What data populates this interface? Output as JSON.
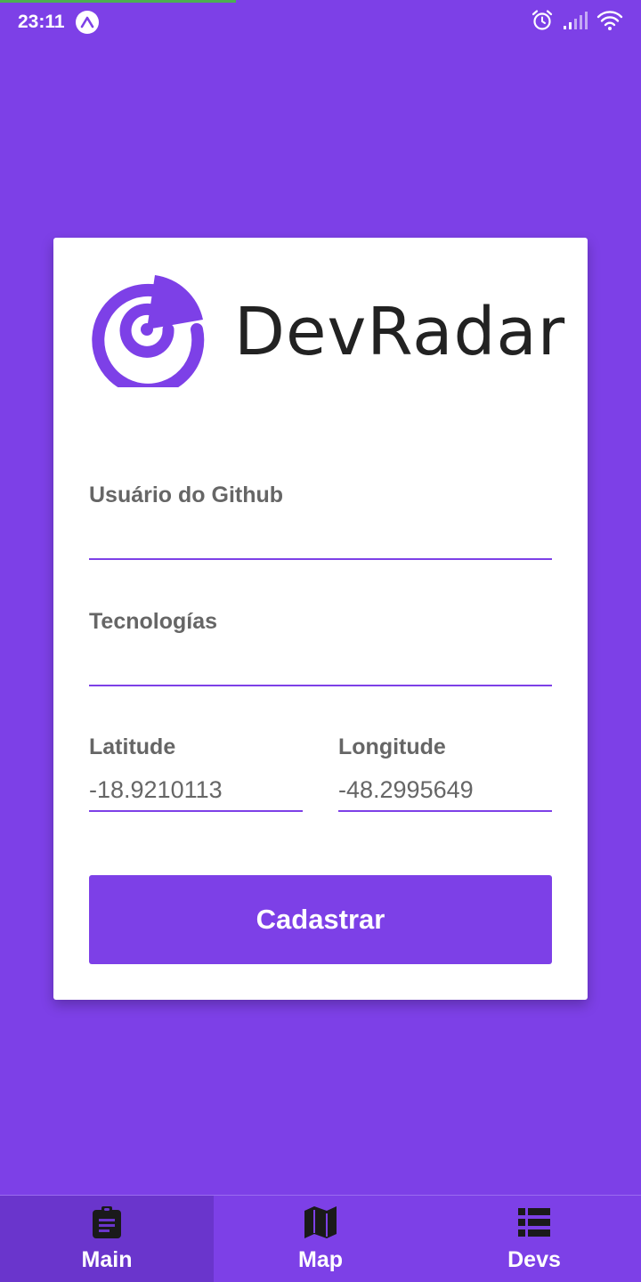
{
  "status_bar": {
    "time": "23:11",
    "icons": [
      "expo-icon",
      "alarm-icon",
      "signal-icon",
      "wifi-icon"
    ]
  },
  "app": {
    "name": "DevRadar",
    "colors": {
      "primary": "#7d40e7",
      "tab_active": "#6a35cc",
      "text": "#666666"
    }
  },
  "form": {
    "github": {
      "label": "Usuário do Github",
      "value": ""
    },
    "techs": {
      "label": "Tecnologías",
      "value": ""
    },
    "latitude": {
      "label": "Latitude",
      "value": "-18.9210113"
    },
    "longitude": {
      "label": "Longitude",
      "value": "-48.2995649"
    },
    "submit_label": "Cadastrar"
  },
  "tabs": [
    {
      "label": "Main",
      "icon": "clipboard-icon",
      "active": true
    },
    {
      "label": "Map",
      "icon": "map-icon",
      "active": false
    },
    {
      "label": "Devs",
      "icon": "list-icon",
      "active": false
    }
  ]
}
